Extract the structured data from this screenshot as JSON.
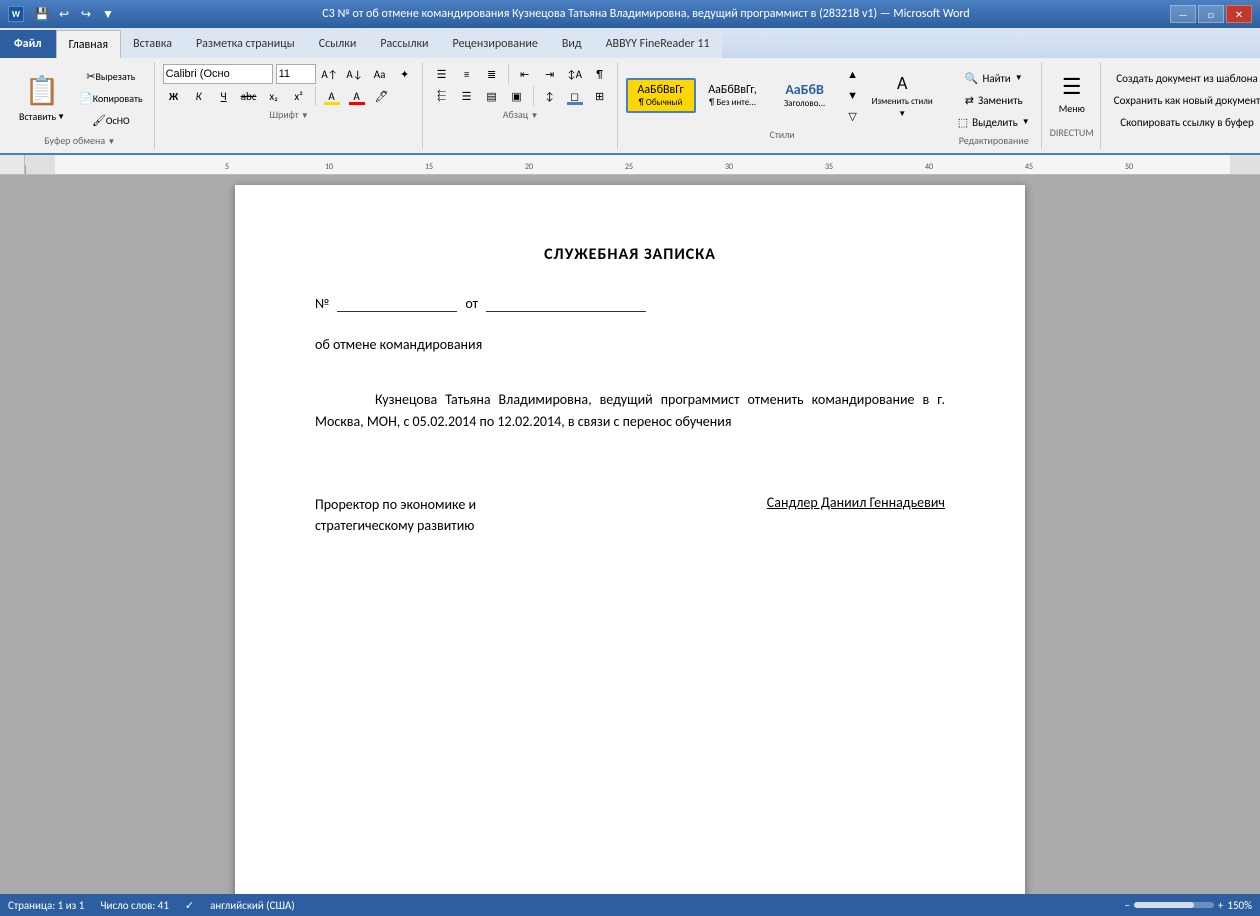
{
  "titleBar": {
    "title": "С3 №  от  об отмене командирования Кузнецова Татьяна Владимировна, ведущий программист в (283218 v1) — Microsoft Word",
    "appName": "Microsoft Word",
    "minimize": "—",
    "maximize": "□",
    "close": "✕"
  },
  "quickAccess": {
    "save": "💾",
    "undo": "↩",
    "redo": "↪",
    "more": "▼"
  },
  "tabs": [
    {
      "id": "file",
      "label": "Файл",
      "active": false,
      "isFile": true
    },
    {
      "id": "home",
      "label": "Главная",
      "active": true
    },
    {
      "id": "insert",
      "label": "Вставка",
      "active": false
    },
    {
      "id": "layout",
      "label": "Разметка страницы",
      "active": false
    },
    {
      "id": "refs",
      "label": "Ссылки",
      "active": false
    },
    {
      "id": "mailing",
      "label": "Рассылки",
      "active": false
    },
    {
      "id": "review",
      "label": "Рецензирование",
      "active": false
    },
    {
      "id": "view",
      "label": "Вид",
      "active": false
    },
    {
      "id": "abbyy",
      "label": "ABBYY FineReader 11",
      "active": false
    }
  ],
  "ribbon": {
    "clipboard": {
      "label": "Буфер обмена",
      "paste": "Вставить",
      "cut": "Вырезать",
      "copy": "Копировать",
      "formatPainter": "OcHO"
    },
    "font": {
      "label": "Шрифт",
      "fontFamily": "Calibri (Осно",
      "fontSize": "11",
      "bold": "Ж",
      "italic": "К",
      "underline": "Ч",
      "strikethrough": "abc",
      "subscript": "x₂",
      "superscript": "x²"
    },
    "paragraph": {
      "label": "Абзац",
      "bulletList": "≡",
      "numberedList": "≡",
      "indent": "⇥",
      "alignLeft": "≡",
      "alignCenter": "≡",
      "alignRight": "≡",
      "justify": "≡",
      "lineSpacing": "↕"
    },
    "styles": {
      "label": "Стили",
      "items": [
        {
          "id": "normal",
          "label": "АаБбВвГг",
          "sublabel": "¶ Обычный",
          "active": true
        },
        {
          "id": "noSpacing",
          "label": "АаБбВвГг,",
          "sublabel": "¶ Без инте..."
        },
        {
          "id": "heading1",
          "label": "АаБбВ",
          "sublabel": "Заголово..."
        }
      ]
    },
    "edit": {
      "label": "Редактирование",
      "find": "Найти",
      "replace": "Заменить",
      "select": "Выделить"
    },
    "changeStyles": "Изменить стили",
    "menu": "Меню",
    "directum": {
      "label": "DIRECTUM",
      "createFromTemplate": "Создать документ из шаблона",
      "saveAsNew": "Сохранить как новый документ",
      "copyLink": "Скопировать ссылку в буфер"
    }
  },
  "document": {
    "title": "СЛУЖЕБНАЯ ЗАПИСКА",
    "numberLabel": "№",
    "numberUnderline": "_____________________",
    "fromLabel": "от",
    "fromUnderline": "_____________________",
    "subtitle": "об отмене командирования",
    "body": "Кузнецова Татьяна Владимировна, ведущий программист отменить командирование в г. Москва, МОН, с 05.02.2014 по 12.02.2014, в связи с перенос обучения",
    "sigLeftLine1": "Проректор по экономике и",
    "sigLeftLine2": "стратегическому развитию",
    "sigRight": "Сандлер Даниил Геннадьевич"
  },
  "statusBar": {
    "page": "Страница: 1 из 1",
    "words": "Число слов: 41",
    "language": "английский (США)",
    "zoom": "150%"
  }
}
